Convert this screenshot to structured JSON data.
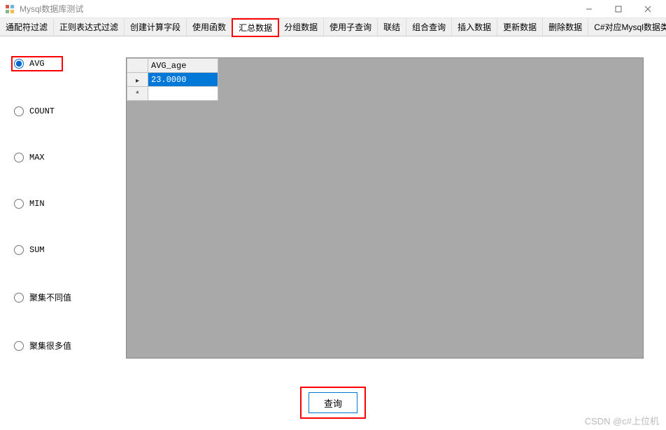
{
  "window": {
    "title": "Mysql数据库测试"
  },
  "tabs": [
    {
      "label": "通配符过滤"
    },
    {
      "label": "正则表达式过滤"
    },
    {
      "label": "创建计算字段"
    },
    {
      "label": "使用函数"
    },
    {
      "label": "汇总数据"
    },
    {
      "label": "分组数据"
    },
    {
      "label": "使用子查询"
    },
    {
      "label": "联结"
    },
    {
      "label": "组合查询"
    },
    {
      "label": "插入数据"
    },
    {
      "label": "更新数据"
    },
    {
      "label": "删除数据"
    },
    {
      "label": "C#对应Mysql数据类型"
    }
  ],
  "radios": {
    "avg": "AVG",
    "count": "COUNT",
    "max": "MAX",
    "min": "MIN",
    "sum": "SUM",
    "agg_distinct": "聚集不同值",
    "agg_many": "聚集很多值"
  },
  "grid": {
    "header": "AVG_age",
    "value": "23.0000",
    "newrow_marker": "*"
  },
  "actions": {
    "query": "查询"
  },
  "watermark": "CSDN @c#上位机"
}
